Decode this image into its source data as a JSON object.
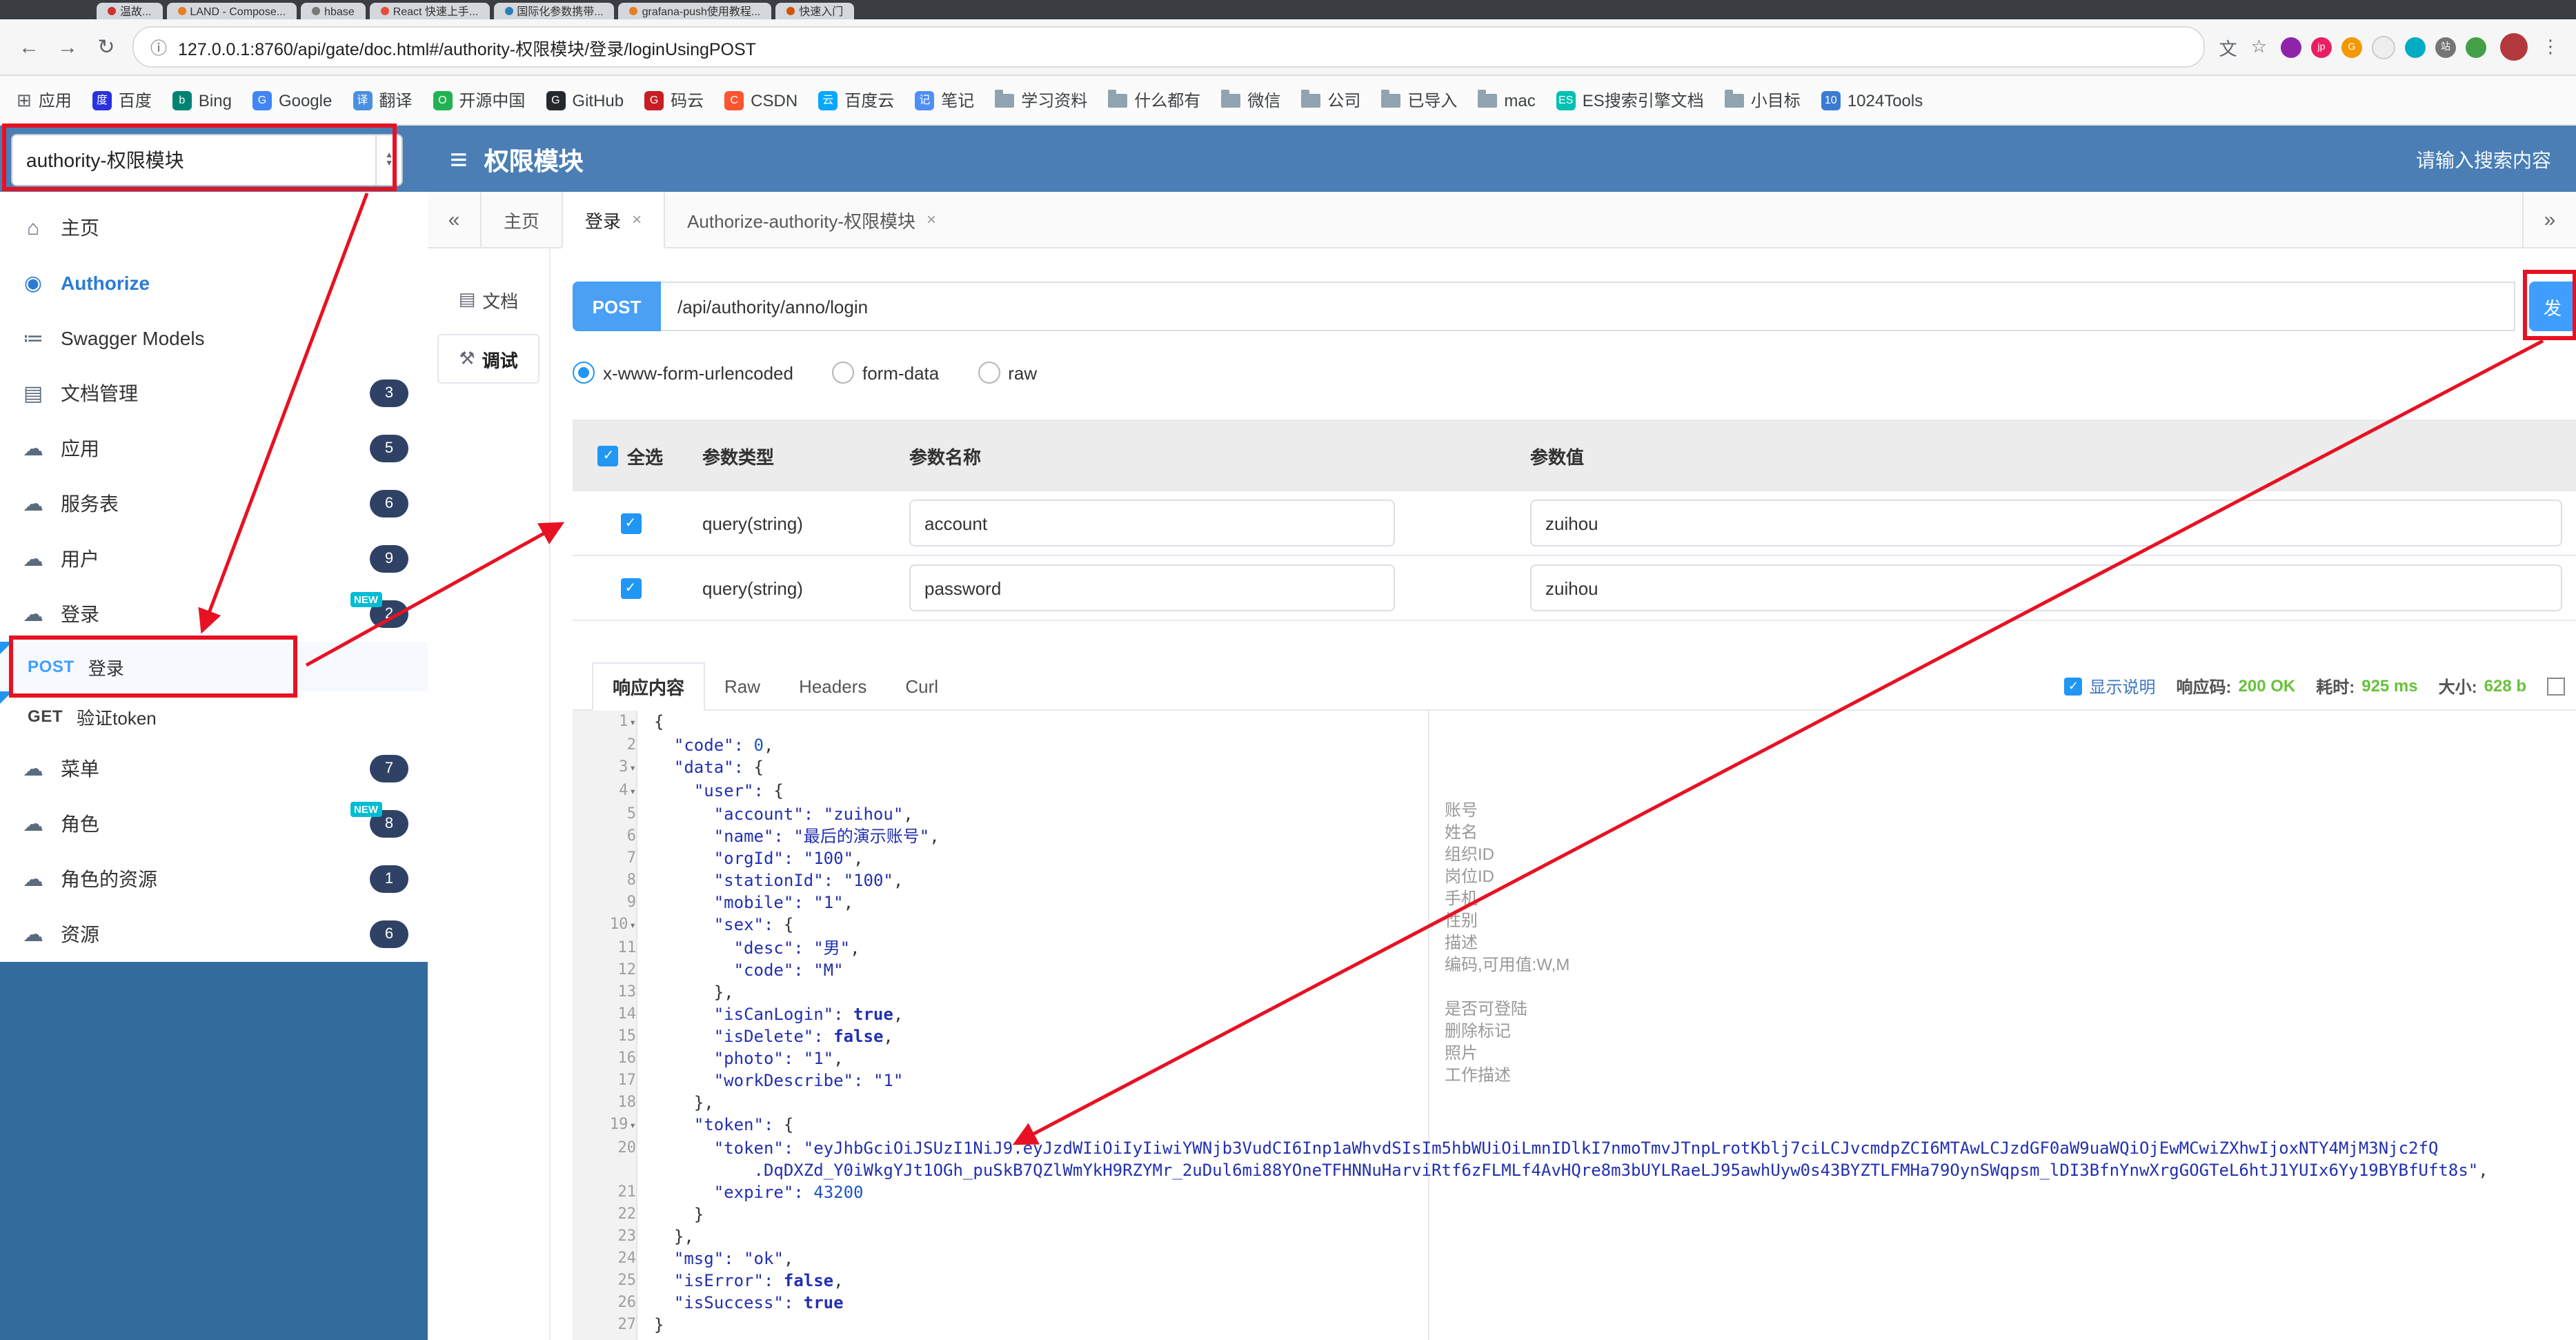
{
  "colors": {
    "header_blue": "#4a7eb5",
    "sidebar_blue": "#336b9e",
    "accent_blue": "#409eff",
    "post_badge_blue": "#49a0f5",
    "success_green": "#67c23a",
    "annotation_red": "#e81123",
    "badge_navy": "#2f4266",
    "new_teal": "#00bcd4"
  },
  "icons": {
    "back": "←",
    "forward": "→",
    "reload": "↻",
    "info": "ⓘ",
    "translate": "文",
    "star": "☆",
    "menu_dots": "⋮",
    "hamburger": "≡",
    "collapse": "«",
    "expand": "»",
    "apps_grid": "⊞",
    "home": "⌂",
    "cloud": "☁",
    "doc": "▤",
    "models": "≔",
    "lock": "◉",
    "debug": "⚒",
    "check": "✓",
    "fold": "▾",
    "close": "×",
    "select_up": "▲",
    "select_down": "▼"
  },
  "browser": {
    "tabs": [
      {
        "label": "温故...",
        "favicon": "#cc3333"
      },
      {
        "label": "LAND - Compose...",
        "favicon": "#e67e22"
      },
      {
        "label": "hbase",
        "favicon": "#777777"
      },
      {
        "label": "React 快速上手...",
        "favicon": "#e74c3c"
      },
      {
        "label": "国际化参数携带...",
        "favicon": "#2980b9"
      },
      {
        "label": "grafana-push使用教程...",
        "favicon": "#e67e22"
      },
      {
        "label": "快速入门",
        "favicon": "#d35400"
      }
    ],
    "url": "127.0.0.1:8760/api/gate/doc.html#/authority-权限模块/登录/loginUsingPOST",
    "extensions": [
      {
        "color": "#8e24aa",
        "label": ""
      },
      {
        "color": "#e91e63",
        "label": "jp"
      },
      {
        "color": "#f29900",
        "label": "G"
      },
      {
        "color": "#eeeeee",
        "label": ""
      },
      {
        "color": "#00acc1",
        "label": ""
      },
      {
        "color": "#757575",
        "label": "站"
      },
      {
        "color": "#43a047",
        "label": ""
      }
    ],
    "bookmarks": [
      {
        "label": "应用",
        "type": "grid"
      },
      {
        "label": "百度",
        "type": "fav",
        "letter": "度",
        "color": "#2932e1"
      },
      {
        "label": "Bing",
        "type": "fav",
        "letter": "b",
        "color": "#008373"
      },
      {
        "label": "Google",
        "type": "fav",
        "letter": "G",
        "color": "#4285f4"
      },
      {
        "label": "翻译",
        "type": "fav",
        "letter": "译",
        "color": "#4a90e2"
      },
      {
        "label": "开源中国",
        "type": "fav",
        "letter": "O",
        "color": "#21b351"
      },
      {
        "label": "GitHub",
        "type": "fav",
        "letter": "G",
        "color": "#24292e"
      },
      {
        "label": "码云",
        "type": "fav",
        "letter": "G",
        "color": "#c71d23"
      },
      {
        "label": "CSDN",
        "type": "fav",
        "letter": "C",
        "color": "#fc5531"
      },
      {
        "label": "百度云",
        "type": "fav",
        "letter": "云",
        "color": "#06a7ff"
      },
      {
        "label": "笔记",
        "type": "fav",
        "letter": "记",
        "color": "#4f8ef7"
      },
      {
        "label": "学习资料",
        "type": "folder"
      },
      {
        "label": "什么都有",
        "type": "folder"
      },
      {
        "label": "微信",
        "type": "folder"
      },
      {
        "label": "公司",
        "type": "folder"
      },
      {
        "label": "已导入",
        "type": "folder"
      },
      {
        "label": "mac",
        "type": "folder"
      },
      {
        "label": "ES搜索引擎文档",
        "type": "fav",
        "letter": "ES",
        "color": "#00bfb3"
      },
      {
        "label": "小目标",
        "type": "folder"
      },
      {
        "label": "1024Tools",
        "type": "fav",
        "letter": "10",
        "color": "#3a7bd5"
      }
    ]
  },
  "header": {
    "module_select": "authority-权限模块",
    "title": "权限模块",
    "search_placeholder": "请输入搜索内容"
  },
  "sidebar": {
    "items": [
      {
        "key": "home",
        "label": "主页",
        "icon": "home"
      },
      {
        "key": "authorize",
        "label": "Authorize",
        "icon": "lock",
        "style": "authorize"
      },
      {
        "key": "swagger-models",
        "label": "Swagger Models",
        "icon": "models"
      },
      {
        "key": "doc-manage",
        "label": "文档管理",
        "icon": "doc",
        "badge": 3
      },
      {
        "key": "app",
        "label": "应用",
        "icon": "cloud",
        "badge": 5
      },
      {
        "key": "service",
        "label": "服务表",
        "icon": "cloud",
        "badge": 6
      },
      {
        "key": "user",
        "label": "用户",
        "icon": "cloud",
        "badge": 9
      },
      {
        "key": "login",
        "label": "登录",
        "icon": "cloud",
        "badge": 2,
        "new": true,
        "children": [
          {
            "key": "login-post",
            "method": "POST",
            "label": "登录",
            "highlight": true
          },
          {
            "key": "verify-token-get",
            "method": "GET",
            "label": "验证token"
          }
        ]
      },
      {
        "key": "menu",
        "label": "菜单",
        "icon": "cloud",
        "badge": 7
      },
      {
        "key": "role",
        "label": "角色",
        "icon": "cloud",
        "badge": 8,
        "new": true
      },
      {
        "key": "role-resource",
        "label": "角色的资源",
        "icon": "cloud",
        "badge": 1
      },
      {
        "key": "resource",
        "label": "资源",
        "icon": "cloud",
        "badge": 6
      }
    ]
  },
  "doc_tabs": {
    "tabs": [
      {
        "key": "home",
        "label": "主页",
        "closable": false,
        "active": false
      },
      {
        "key": "login",
        "label": "登录",
        "closable": true,
        "active": true
      },
      {
        "key": "authorize",
        "label": "Authorize-authority-权限模块",
        "closable": true,
        "active": false
      }
    ]
  },
  "subnav": [
    {
      "key": "doc",
      "label": "文档",
      "active": false
    },
    {
      "key": "debug",
      "label": "调试",
      "active": true
    }
  ],
  "request": {
    "method": "POST",
    "url": "/api/authority/anno/login",
    "send_label": "发",
    "content_types": [
      {
        "label": "x-www-form-urlencoded",
        "selected": true
      },
      {
        "label": "form-data",
        "selected": false
      },
      {
        "label": "raw",
        "selected": false
      }
    ]
  },
  "params": {
    "headers": [
      "全选",
      "参数类型",
      "参数名称",
      "参数值"
    ],
    "rows": [
      {
        "checked": true,
        "type": "query(string)",
        "name": "account",
        "value": "zuihou"
      },
      {
        "checked": true,
        "type": "query(string)",
        "name": "password",
        "value": "zuihou"
      }
    ]
  },
  "response": {
    "tabs": [
      "响应内容",
      "Raw",
      "Headers",
      "Curl"
    ],
    "active_tab": "响应内容",
    "show_desc": "显示说明",
    "status_label": "响应码:",
    "status_value": "200 OK",
    "time_label": "耗时:",
    "time_value": "925 ms",
    "size_label": "大小:",
    "size_value": "628 b"
  },
  "editor": {
    "lines": [
      {
        "num": 1,
        "text": "{"
      },
      {
        "num": 2,
        "text": "  \"code\": 0,"
      },
      {
        "num": 3,
        "text": "  \"data\": {"
      },
      {
        "num": 4,
        "text": "    \"user\": {"
      },
      {
        "num": 5,
        "text": "      \"account\": \"zuihou\","
      },
      {
        "num": 6,
        "text": "      \"name\": \"最后的演示账号\","
      },
      {
        "num": 7,
        "text": "      \"orgId\": \"100\","
      },
      {
        "num": 8,
        "text": "      \"stationId\": \"100\","
      },
      {
        "num": 9,
        "text": "      \"mobile\": \"1\","
      },
      {
        "num": 10,
        "text": "      \"sex\": {"
      },
      {
        "num": 11,
        "text": "        \"desc\": \"男\","
      },
      {
        "num": 12,
        "text": "        \"code\": \"M\""
      },
      {
        "num": 13,
        "text": "      },"
      },
      {
        "num": 14,
        "text": "      \"isCanLogin\": true,"
      },
      {
        "num": 15,
        "text": "      \"isDelete\": false,"
      },
      {
        "num": 16,
        "text": "      \"photo\": \"1\","
      },
      {
        "num": 17,
        "text": "      \"workDescribe\": \"1\""
      },
      {
        "num": 18,
        "text": "    },"
      },
      {
        "num": 19,
        "text": "    \"token\": {"
      },
      {
        "num": 20,
        "text": "      \"token\": \"eyJhbGciOiJSUzI1NiJ9.eyJzdWIiOiIyIiwiYWNjb3VudCI6Inp1aWhvdSIsIm5hbWUiOiLmnIDlkI7nmoTmvJTnpLrotKblj7ciLCJvcmdpZCI6MTAwLCJzdGF0aW9uaWQiOjEwMCwiZXhwIjoxNTY4MjM3Njc2fQ\n          .DqDXZd_Y0iWkgYJt1OGh_puSkB7QZlWmYkH9RZYMr_2uDul6mi88YOneTFHNNuHarviRtf6zFLMLf4AvHQre8m3bUYLRaeLJ95awhUyw0s43BYZTLFMHa79OynSWqpsm_lDI3BfnYnwXrgGOGTeL6htJ1YUIx6Yy19BYBfUft8s\","
      },
      {
        "num": 21,
        "text": "      \"expire\": 43200"
      },
      {
        "num": 22,
        "text": "    }"
      },
      {
        "num": 23,
        "text": "  },"
      },
      {
        "num": 24,
        "text": "  \"msg\": \"ok\","
      },
      {
        "num": 25,
        "text": "  \"isError\": false,"
      },
      {
        "num": 26,
        "text": "  \"isSuccess\": true"
      },
      {
        "num": 27,
        "text": "}"
      }
    ],
    "annotations": {
      "5": "账号",
      "6": "姓名",
      "7": "组织ID",
      "8": "岗位ID",
      "9": "手机",
      "10": "性别",
      "11": "描述",
      "12": "编码,可用值:W,M",
      "14": "是否可登陆",
      "15": "删除标记",
      "16": "照片",
      "17": "工作描述"
    }
  }
}
